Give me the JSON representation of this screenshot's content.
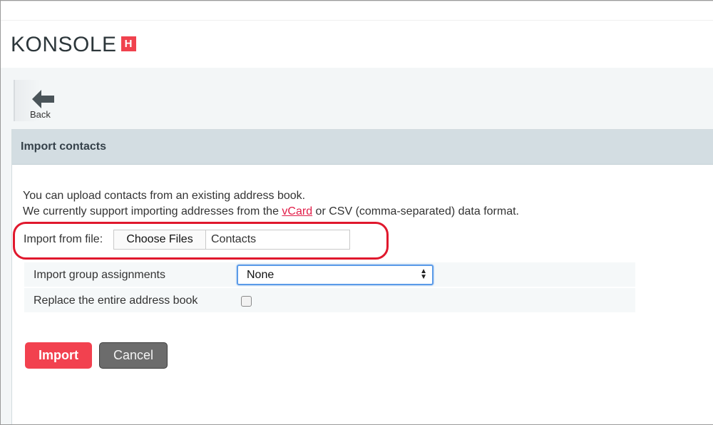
{
  "header": {
    "logo_text": "KONSOLE",
    "logo_badge": "H",
    "brand_color": "#f0424e"
  },
  "toolbar": {
    "back_label": "Back",
    "back_icon": "arrow-left-icon"
  },
  "panel": {
    "title": "Import contacts",
    "intro_line1": "You can upload contacts from an existing address book.",
    "intro_line2_pre": "We currently support importing addresses from the ",
    "intro_link": "vCard",
    "intro_line2_post": " or CSV (comma-separated) data format.",
    "import_label": "Import from file:",
    "choose_files_label": "Choose Files",
    "file_name": "Contacts",
    "options": [
      {
        "label": "Import group assignments",
        "selected": "None"
      },
      {
        "label": "Replace the entire address book",
        "checked": false
      }
    ],
    "import_button": "Import",
    "cancel_button": "Cancel"
  }
}
